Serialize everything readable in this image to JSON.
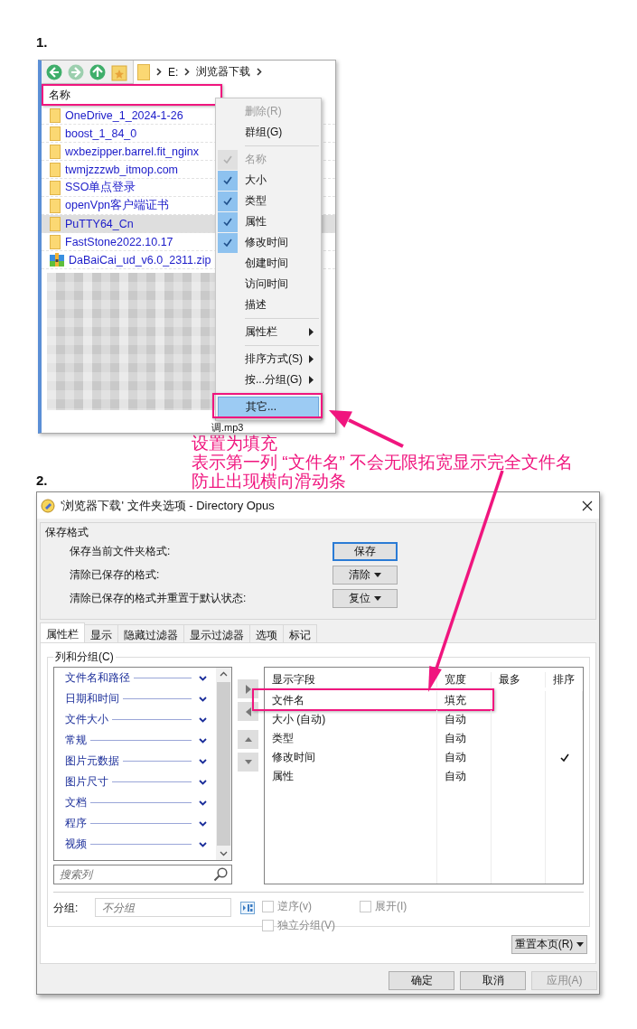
{
  "step1": {
    "label": "1.",
    "explorer": {
      "path": [
        "E:",
        "浏览器下载"
      ],
      "column_header": {
        "label": "名称",
        "highlighted": true
      },
      "files": [
        {
          "name": "OneDrive_1_2024-1-26",
          "kind": "folder",
          "selected": false
        },
        {
          "name": "boost_1_84_0",
          "kind": "folder",
          "selected": false
        },
        {
          "name": "wxbezipper.barrel.fit_nginx",
          "kind": "folder",
          "selected": false
        },
        {
          "name": "twmjzzzwb_itmop.com",
          "kind": "folder",
          "selected": false
        },
        {
          "name": "SSO单点登录",
          "kind": "folder",
          "selected": false
        },
        {
          "name": "openVpn客户端证书",
          "kind": "folder",
          "selected": false
        },
        {
          "name": "PuTTY64_Cn",
          "kind": "folder",
          "selected": true
        },
        {
          "name": "FastStone2022.10.17",
          "kind": "folder",
          "selected": false
        },
        {
          "name": "DaBaiCai_ud_v6.0_2311.zip",
          "kind": "archive",
          "selected": false
        }
      ],
      "partial_file": "调.mp3"
    },
    "context_menu": [
      {
        "kind": "command",
        "label": "删除(R)",
        "disabled": true,
        "selected": false,
        "highlighted": false
      },
      {
        "kind": "command",
        "label": "群组(G)",
        "disabled": false,
        "selected": false,
        "highlighted": false
      },
      {
        "kind": "separator"
      },
      {
        "kind": "check",
        "label": "名称",
        "checked": true,
        "disabled": true,
        "selected": false,
        "highlighted": false
      },
      {
        "kind": "check",
        "label": "大小",
        "checked": true,
        "disabled": false,
        "selected": false,
        "highlighted": false
      },
      {
        "kind": "check",
        "label": "类型",
        "checked": true,
        "disabled": false,
        "selected": false,
        "highlighted": false
      },
      {
        "kind": "check",
        "label": "属性",
        "checked": true,
        "disabled": false,
        "selected": false,
        "highlighted": false
      },
      {
        "kind": "check",
        "label": "修改时间",
        "checked": true,
        "disabled": false,
        "selected": false,
        "highlighted": false
      },
      {
        "kind": "check",
        "label": "创建时间",
        "checked": false,
        "disabled": false,
        "selected": false,
        "highlighted": false
      },
      {
        "kind": "check",
        "label": "访问时间",
        "checked": false,
        "disabled": false,
        "selected": false,
        "highlighted": false
      },
      {
        "kind": "check",
        "label": "描述",
        "checked": false,
        "disabled": false,
        "selected": false,
        "highlighted": false
      },
      {
        "kind": "separator"
      },
      {
        "kind": "submenu",
        "label": "属性栏",
        "disabled": false,
        "selected": false,
        "highlighted": false
      },
      {
        "kind": "separator"
      },
      {
        "kind": "submenu",
        "label": "排序方式(S)",
        "disabled": false,
        "selected": false,
        "highlighted": false
      },
      {
        "kind": "submenu",
        "label": "按...分组(G)",
        "disabled": false,
        "selected": false,
        "highlighted": false
      },
      {
        "kind": "separator"
      },
      {
        "kind": "command",
        "label": "其它...",
        "disabled": false,
        "selected": true,
        "highlighted": true
      }
    ],
    "annotation": [
      "设置为填充",
      "表示第一列 “文件名” 不会无限拓宽显示完全文件名",
      "防止出现横向滑动条"
    ]
  },
  "step2": {
    "label": "2.",
    "dialog": {
      "title": "'浏览器下载' 文件夹选项 - Directory Opus",
      "save_format": {
        "title": "保存格式",
        "rows": [
          {
            "label": "保存当前文件夹格式:",
            "button": "保存",
            "dropdown": false,
            "focused": true
          },
          {
            "label": "清除已保存的格式:",
            "button": "清除",
            "dropdown": true,
            "focused": false
          },
          {
            "label": "清除已保存的格式并重置于默认状态:",
            "button": "复位",
            "dropdown": true,
            "focused": false
          }
        ]
      },
      "tabs": [
        {
          "label": "属性栏",
          "selected": true
        },
        {
          "label": "显示",
          "selected": false
        },
        {
          "label": "隐藏过滤器",
          "selected": false
        },
        {
          "label": "显示过滤器",
          "selected": false
        },
        {
          "label": "选项",
          "selected": false
        },
        {
          "label": "标记",
          "selected": false
        }
      ],
      "columns_group": {
        "title": "列和分组(C)",
        "categories": [
          "文件名和路径",
          "日期和时间",
          "文件大小",
          "常规",
          "图片元数据",
          "图片尺寸",
          "文档",
          "程序",
          "视频"
        ],
        "search_placeholder": "搜索列",
        "table": {
          "columns": [
            "显示字段",
            "宽度",
            "最多",
            "排序"
          ],
          "rows": [
            {
              "field": "文件名",
              "width": "填充",
              "sorted": false,
              "highlighted": true
            },
            {
              "field": "大小 (自动)",
              "width": "自动",
              "sorted": false,
              "highlighted": false
            },
            {
              "field": "类型",
              "width": "自动",
              "sorted": false,
              "highlighted": false
            },
            {
              "field": "修改时间",
              "width": "自动",
              "sorted": true,
              "highlighted": false
            },
            {
              "field": "属性",
              "width": "自动",
              "sorted": false,
              "highlighted": false
            }
          ]
        }
      },
      "grouping": {
        "label": "分组:",
        "placeholder": "不分组",
        "options": [
          {
            "label": "逆序(v)",
            "checked": false,
            "disabled": true
          },
          {
            "label": "展开(I)",
            "checked": false,
            "disabled": true
          },
          {
            "label": "独立分组(V)",
            "checked": false,
            "disabled": true
          }
        ]
      },
      "reset_button": "重置本页(R)",
      "buttons": [
        {
          "label": "确定",
          "disabled": false
        },
        {
          "label": "取消",
          "disabled": false
        },
        {
          "label": "应用(A)",
          "disabled": true
        }
      ]
    }
  }
}
